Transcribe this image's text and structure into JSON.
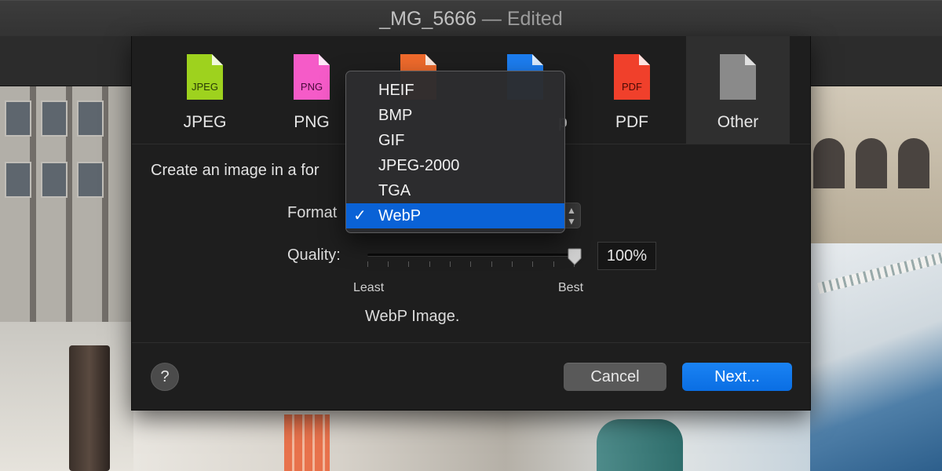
{
  "window": {
    "title_name": "_MG_5666",
    "title_suffix": " — Edited"
  },
  "format_tabs": [
    {
      "label": "JPEG",
      "icon": "jpeg-file-icon",
      "icon_text": "JPEG",
      "color": "#9ed21e"
    },
    {
      "label": "PNG",
      "icon": "png-file-icon",
      "icon_text": "PNG",
      "color": "#f55bc8"
    },
    {
      "label": "",
      "icon": "tiff-file-icon",
      "icon_text": "",
      "color": "#ef6a2c"
    },
    {
      "label": "p",
      "icon": "heic-file-icon",
      "icon_text": "",
      "color": "#1c7df0"
    },
    {
      "label": "PDF",
      "icon": "pdf-file-icon",
      "icon_text": "PDF",
      "color": "#f0402b"
    },
    {
      "label": "Other",
      "icon": "other-file-icon",
      "icon_text": "",
      "color": "#8a8a8a"
    }
  ],
  "active_tab": "Other",
  "description": "Create an image in a for",
  "format": {
    "label": "Format",
    "menu_items": [
      "HEIF",
      "BMP",
      "GIF",
      "JPEG-2000",
      "TGA",
      "WebP"
    ],
    "selected": "WebP",
    "check": "✓"
  },
  "quality": {
    "label": "Quality:",
    "value_text": "100%",
    "level": 1.0,
    "min_label": "Least",
    "max_label": "Best"
  },
  "format_description": "WebP Image.",
  "buttons": {
    "help": "?",
    "cancel": "Cancel",
    "next": "Next..."
  },
  "colors": {
    "accent": "#0a6ee3",
    "menu_highlight": "#0a62d6"
  }
}
